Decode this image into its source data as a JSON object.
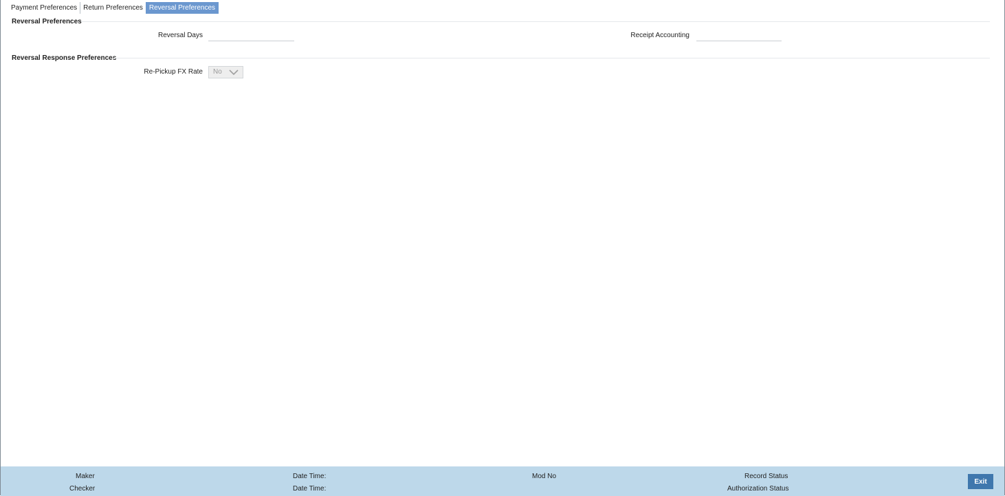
{
  "tabs": [
    {
      "label": "Payment Preferences",
      "active": false
    },
    {
      "label": "Return Preferences",
      "active": false
    },
    {
      "label": "Reversal Preferences",
      "active": true
    }
  ],
  "reversal_preferences": {
    "title": "Reversal Preferences",
    "reversal_days_label": "Reversal Days",
    "reversal_days_value": "",
    "receipt_accounting_label": "Receipt Accounting",
    "receipt_accounting_value": ""
  },
  "reversal_response_preferences": {
    "title": "Reversal Response Preferences",
    "repickup_fx_rate_label": "Re-Pickup FX Rate",
    "repickup_fx_rate_value": "No"
  },
  "footer": {
    "maker_label": "Maker",
    "checker_label": "Checker",
    "date_time_label_1": "Date Time:",
    "date_time_label_2": "Date Time:",
    "mod_no_label": "Mod No",
    "record_status_label": "Record Status",
    "authorization_status_label": "Authorization Status",
    "exit_label": "Exit"
  },
  "colors": {
    "active_tab": "#6b97cf",
    "footer_bg": "#bdd8ea",
    "exit_button": "#3f77ad"
  }
}
